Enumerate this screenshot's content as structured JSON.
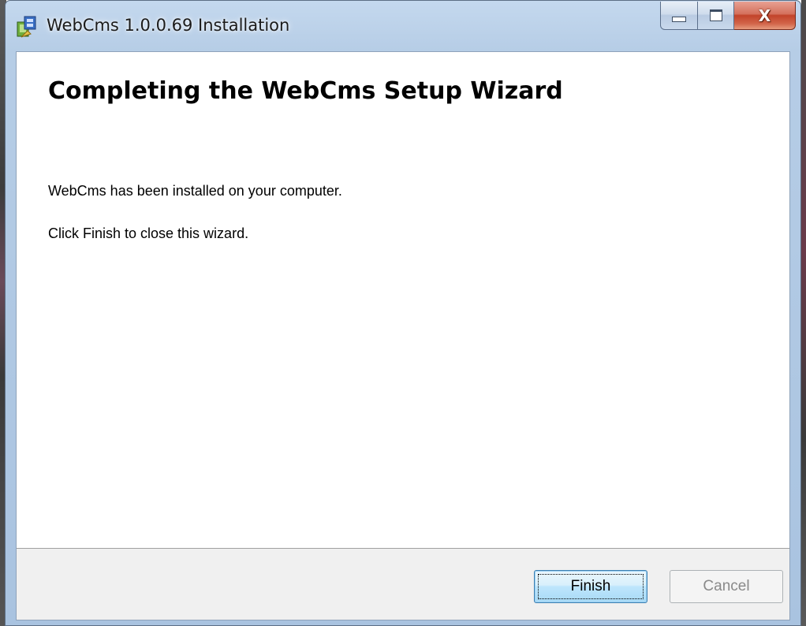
{
  "window": {
    "title": "WebCms 1.0.0.69 Installation"
  },
  "caption": {
    "minimize_icon": "minimize-icon",
    "maximize_icon": "maximize-icon",
    "close_icon": "close-icon",
    "close_glyph": "X"
  },
  "content": {
    "heading": "Completing the WebCms Setup Wizard",
    "message_installed": "WebCms has been installed on your computer.",
    "message_finish": "Click Finish to close this wizard."
  },
  "buttons": {
    "finish_label": "Finish",
    "cancel_label": "Cancel",
    "cancel_enabled": false
  },
  "colors": {
    "close_button": "#c2432a",
    "title_bar": "#b6cde6",
    "footer_bg": "#f0f0f0",
    "disabled_text": "#8a8a8a"
  }
}
